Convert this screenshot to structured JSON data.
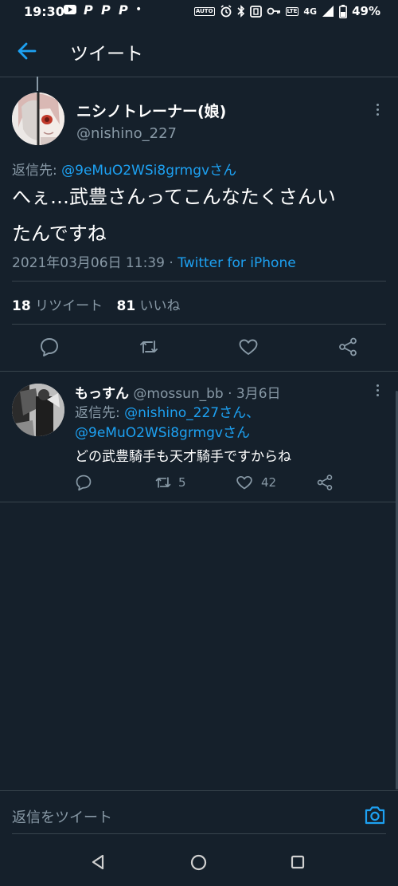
{
  "status_bar": {
    "time": "19:30",
    "battery": "49%",
    "network": "4G",
    "dot": "•",
    "auto_badge": "AUTO",
    "volte_badge": "LTE"
  },
  "header": {
    "title": "ツイート"
  },
  "main_tweet": {
    "display_name": "ニシノトレーナー(娘)",
    "handle": "@nishino_227",
    "reply_prefix": "返信先: ",
    "reply_to": "@9eMuO2WSi8grmgvさん",
    "text_line1": "へぇ…武豊さんってこんなたくさんい",
    "text_line2": "たんですね",
    "timestamp": "2021年03月06日 11:39 · ",
    "source": "Twitter for iPhone",
    "retweet_count": "18",
    "retweet_label": " リツイート",
    "like_count": "81",
    "like_label": " いいね"
  },
  "reply_tweet": {
    "display_name": "もっすん",
    "handle_time": " @mossun_bb · 3月6日",
    "reply_prefix": "返信先: ",
    "reply_to_line1": "@nishino_227さん、",
    "reply_to_line2": "@9eMuO2WSi8grmgvさん",
    "text": "どの武豊騎手も天才騎手ですからね",
    "retweet_count": "5",
    "like_count": "42"
  },
  "composer": {
    "placeholder": "返信をツイート"
  },
  "colors": {
    "background": "#15202b",
    "accent": "#1da1f2",
    "muted": "#8899a6",
    "divider": "#38444d"
  }
}
